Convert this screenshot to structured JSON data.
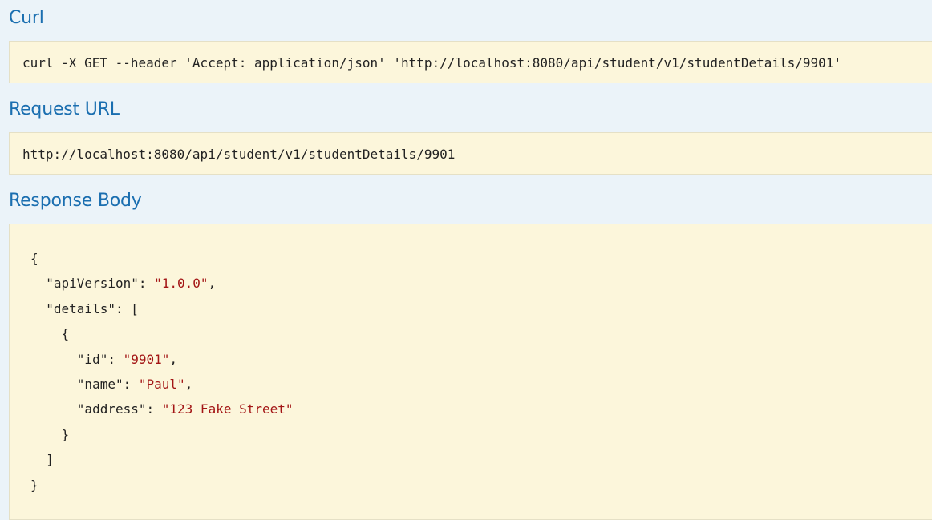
{
  "curl": {
    "title": "Curl",
    "command": "curl -X GET --header 'Accept: application/json' 'http://localhost:8080/api/student/v1/studentDetails/9901'"
  },
  "request_url": {
    "title": "Request URL",
    "url": "http://localhost:8080/api/student/v1/studentDetails/9901"
  },
  "response_body": {
    "title": "Response Body",
    "json": {
      "open_brace": "{",
      "api_version_key": "\"apiVersion\"",
      "api_version_value": "\"1.0.0\"",
      "details_key": "\"details\"",
      "details_open": "[",
      "item_open": "{",
      "id_key": "\"id\"",
      "id_value": "\"9901\"",
      "name_key": "\"name\"",
      "name_value": "\"Paul\"",
      "address_key": "\"address\"",
      "address_value": "\"123 Fake Street\"",
      "item_close": "}",
      "details_close": "]",
      "close_brace": "}"
    }
  },
  "colors": {
    "background": "#ebf3f9",
    "heading": "#1a6eb0",
    "code_background": "#fcf6db",
    "string_value": "#a31515"
  }
}
